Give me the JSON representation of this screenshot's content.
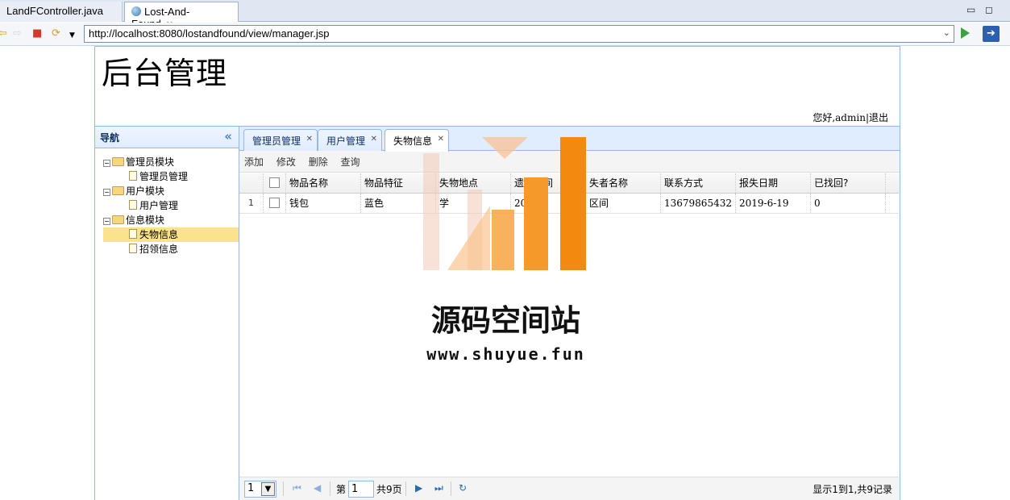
{
  "ide": {
    "tabs": [
      {
        "label": "LandFController.java"
      },
      {
        "label": "Lost-And-Found"
      }
    ],
    "url": "http://localhost:8080/lostandfound/view/manager.jsp"
  },
  "header": {
    "title": "后台管理",
    "welcome": "您好,admin",
    "logout": "退出"
  },
  "nav": {
    "title": "导航",
    "groups": [
      {
        "label": "管理员模块",
        "items": [
          {
            "label": "管理员管理"
          }
        ]
      },
      {
        "label": "用户模块",
        "items": [
          {
            "label": "用户管理"
          }
        ]
      },
      {
        "label": "信息模块",
        "items": [
          {
            "label": "失物信息",
            "selected": true
          },
          {
            "label": "招领信息"
          }
        ]
      }
    ]
  },
  "tabs": [
    {
      "label": "管理员管理"
    },
    {
      "label": "用户管理"
    },
    {
      "label": "失物信息",
      "active": true
    }
  ],
  "toolbar": {
    "add": "添加",
    "edit": "修改",
    "delete": "删除",
    "query": "查询"
  },
  "grid": {
    "columns": [
      "物品名称",
      "物品特征",
      "失物地点",
      "遗失时间",
      "失者名称",
      "联系方式",
      "报失日期",
      "已找回?"
    ],
    "rows": [
      {
        "num": "1",
        "cells": [
          "钱包",
          "蓝色",
          "学",
          "201",
          "区间",
          "13679865432",
          "2019-6-19",
          "0"
        ]
      }
    ]
  },
  "pager": {
    "page_size": "1",
    "page_prefix": "第",
    "page_value": "1",
    "page_suffix": "共9页",
    "info": "显示1到1,共9记录"
  },
  "watermark": {
    "text": "源码空间站",
    "url": "www.shuyue.fun"
  }
}
